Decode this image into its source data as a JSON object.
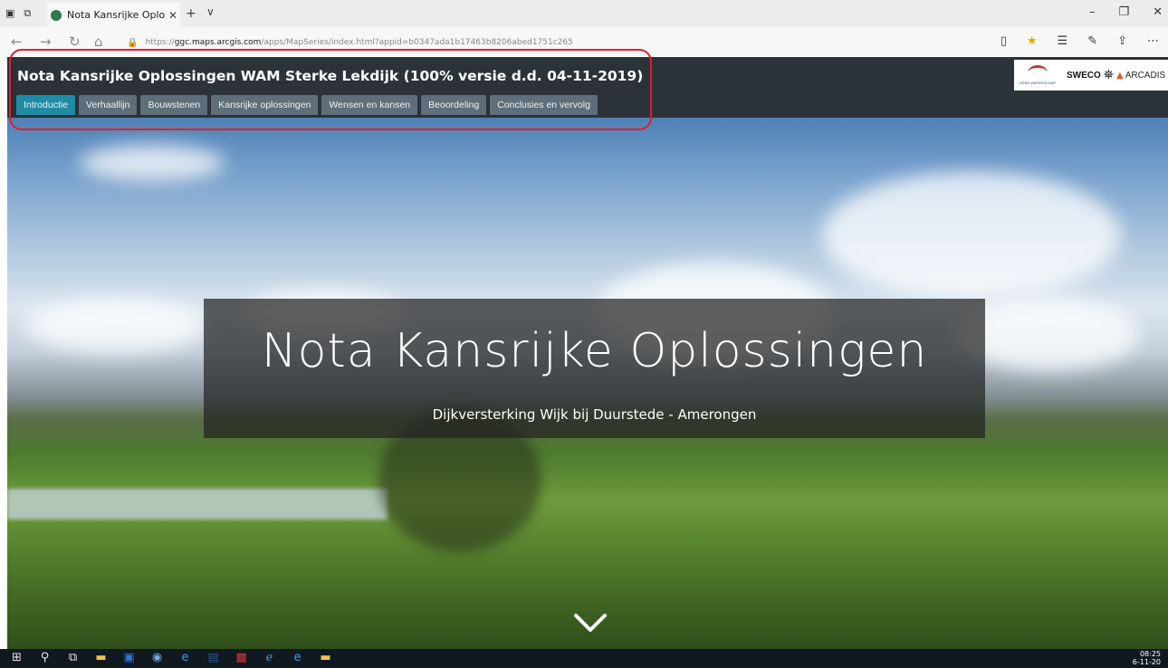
{
  "browser": {
    "tab_title": "Nota Kansrijke Oplossin",
    "url_prefix": "https://",
    "url_host": "ggc.maps.arcgis.com",
    "url_path": "/apps/MapSeries/index.html?appid=b0347ada1b17463b8206abed1751c265"
  },
  "app": {
    "title": "Nota Kansrijke Oplossingen WAM Sterke Lekdijk (100% versie d.d. 04-11-2019)",
    "tabs": [
      {
        "label": "Introductie",
        "active": true
      },
      {
        "label": "Verhaallijn"
      },
      {
        "label": "Bouwstenen"
      },
      {
        "label": "Kansrijke oplossingen"
      },
      {
        "label": "Wensen en kansen"
      },
      {
        "label": "Beoordeling"
      },
      {
        "label": "Conclusies en vervolg"
      }
    ],
    "logos": {
      "sweco": "SWECO",
      "arcadis": "ARCADIS",
      "hdsr_text": "HDSR WATERSCHAP"
    }
  },
  "hero": {
    "title": "Nota Kansrijke Oplossingen",
    "subtitle": "Dijkversterking Wijk bij Duurstede - Amerongen"
  },
  "taskbar": {
    "time": "08:25",
    "date": "6-11-20"
  },
  "colors": {
    "active_tab": "#1f8ca5",
    "tab": "#5e6e7a",
    "topbar": "#2b3238",
    "highlight": "#e0202a"
  }
}
